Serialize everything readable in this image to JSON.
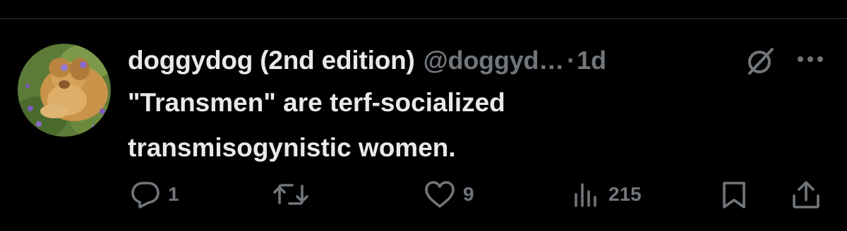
{
  "tweet": {
    "author": {
      "display_name": "doggydog (2nd edition)",
      "handle": "@doggyd…",
      "avatar_icon": "dog-photo-avatar"
    },
    "separator": "·",
    "timestamp": "1d",
    "text_lines": [
      "\"Transmen\" are terf-socialized",
      "transmisogynistic women."
    ],
    "header_icons": [
      "grok-icon",
      "more-icon"
    ]
  },
  "actions": {
    "reply": {
      "icon": "reply-icon",
      "count": "1"
    },
    "repost": {
      "icon": "repost-icon",
      "count": ""
    },
    "like": {
      "icon": "like-icon",
      "count": "9"
    },
    "views": {
      "icon": "views-icon",
      "count": "215"
    },
    "bookmark": {
      "icon": "bookmark-icon"
    },
    "share": {
      "icon": "share-icon"
    }
  },
  "colors": {
    "background": "#000000",
    "primary_text": "#e7e9ea",
    "secondary_text": "#71767b",
    "divider": "#2f3336"
  }
}
